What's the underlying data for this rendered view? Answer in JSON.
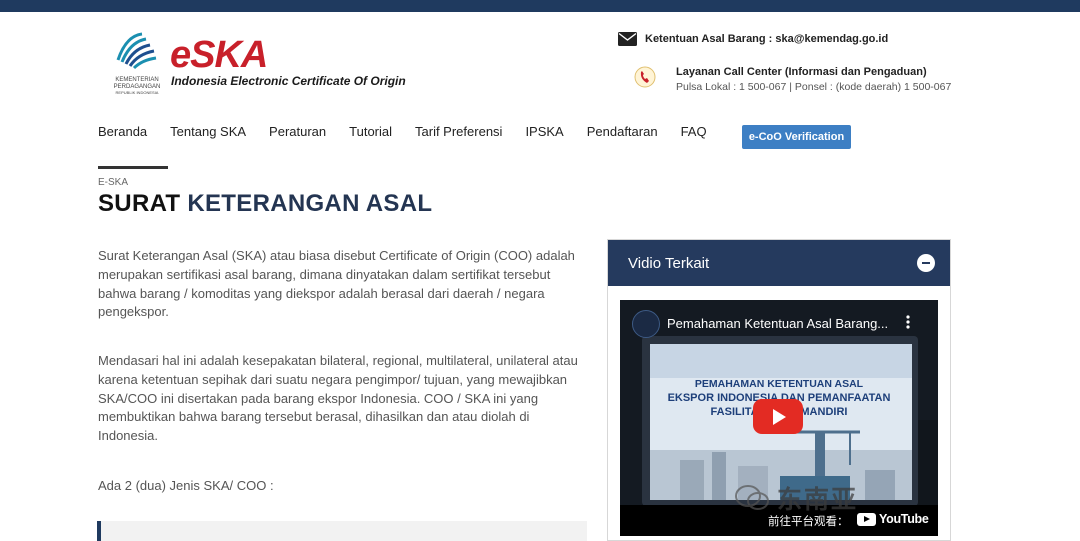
{
  "header": {
    "brand": {
      "ministry_lines": [
        "KEMENTERIAN",
        "PERDAGANGAN"
      ],
      "ministry_sub": "REPUBLIK INDONESIA",
      "logo_e": "e",
      "logo_ska": "SKA",
      "tagline": "Indonesia Electronic Certificate Of Origin"
    },
    "contact": {
      "email_line": "Ketentuan Asal Barang : ska@kemendag.go.id",
      "call_center_title": "Layanan Call Center (Informasi dan Pengaduan)",
      "call_center_numbers": "Pulsa Lokal : 1 500-067 | Ponsel : (kode daerah) 1 500-067"
    }
  },
  "nav": {
    "items": [
      "Beranda",
      "Tentang SKA",
      "Peraturan",
      "Tutorial",
      "Tarif Preferensi",
      "IPSKA",
      "Pendaftaran",
      "FAQ"
    ],
    "verify_button": "e-CoO Verification"
  },
  "main": {
    "breadcrumb": "E-SKA",
    "title_first": "SURAT",
    "title_rest": "KETERANGAN ASAL",
    "paragraphs": [
      "Surat Keterangan Asal (SKA) atau biasa disebut Certificate of Origin (COO) adalah merupakan sertifikasi asal barang, dimana dinyatakan dalam sertifikat tersebut bahwa barang / komoditas yang diekspor adalah berasal dari daerah / negara pengekspor.",
      "Mendasari hal ini adalah kesepakatan bilateral, regional, multilateral, unilateral atau karena ketentuan sepihak dari suatu negara pengimpor/ tujuan, yang mewajibkan SKA/COO ini disertakan pada barang ekspor Indonesia. COO / SKA ini yang membuktikan bahwa barang tersebut berasal, dihasilkan dan atau diolah di Indonesia.",
      "Ada 2 (dua) Jenis SKA/ COO :"
    ]
  },
  "side_panel": {
    "title": "Vidio Terkait",
    "video": {
      "title": "Pemahaman Ketentuan Asal Barang...",
      "headline_lines": [
        "PEMAHAMAN KETENTUAN ASAL",
        "EKSPOR INDONESIA DAN PEMANFAATAN",
        "FASILITAS S          ASI MANDIRI"
      ],
      "watch_label": "前往平台观看：",
      "platform": "YouTube"
    }
  },
  "watermark": {
    "text": "东南亚"
  },
  "colors": {
    "topbar": "#1f3a5f",
    "brand_red": "#c8202a",
    "panel_header": "#253a5e",
    "button_blue": "#3d7fc4",
    "youtube_red": "#e32b23"
  }
}
